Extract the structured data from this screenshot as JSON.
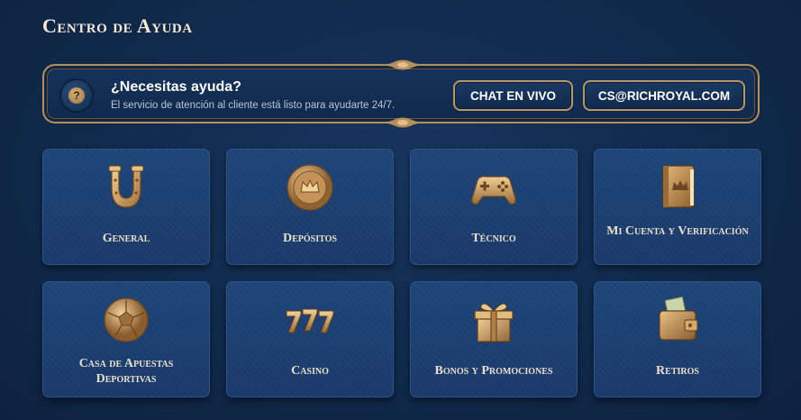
{
  "page": {
    "title": "Centro de Ayuda"
  },
  "help": {
    "icon": "question-icon",
    "title": "¿Necesitas ayuda?",
    "subtitle": "El servicio de atención al cliente está listo para ayudarte 24/7.",
    "chat_label": "CHAT EN VIVO",
    "email_label": "CS@RICHROYAL.COM"
  },
  "categories": [
    {
      "label": "General",
      "icon": "horseshoe-icon"
    },
    {
      "label": "Depósitos",
      "icon": "crown-coin-icon"
    },
    {
      "label": "Técnico",
      "icon": "gamepad-icon"
    },
    {
      "label": "Mi Cuenta y Verificación",
      "icon": "crown-book-icon"
    },
    {
      "label": "Casa de Apuestas Deportivas",
      "icon": "soccer-ball-icon"
    },
    {
      "label": "Casino",
      "icon": "slot-777-icon"
    },
    {
      "label": "Bonos y Promociones",
      "icon": "gift-box-icon"
    },
    {
      "label": "Retiros",
      "icon": "wallet-icon"
    }
  ],
  "colors": {
    "background": "#112a4c",
    "card": "#1c406f",
    "gold": "#c79a5e",
    "text": "#e9dfca"
  }
}
